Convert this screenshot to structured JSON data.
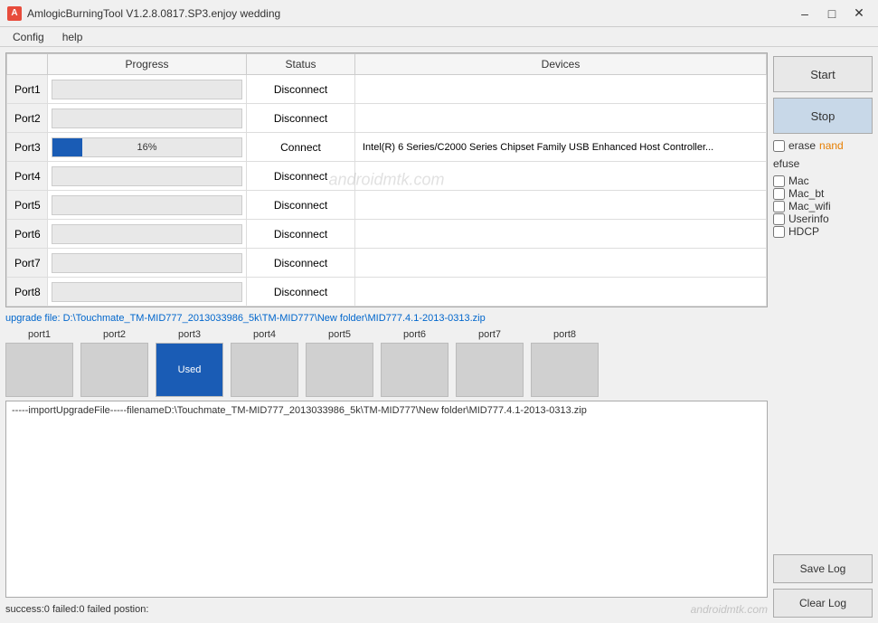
{
  "window": {
    "title": "AmlogicBurningTool  V1.2.8.0817.SP3.enjoy wedding",
    "icon_label": "A"
  },
  "menu": {
    "items": [
      "Config",
      "help"
    ]
  },
  "table": {
    "headers": [
      "Progress",
      "Status",
      "Devices"
    ],
    "rows": [
      {
        "port": "Port1",
        "progress": 0,
        "progress_text": "",
        "status": "Disconnect",
        "devices": ""
      },
      {
        "port": "Port2",
        "progress": 0,
        "progress_text": "",
        "status": "Disconnect",
        "devices": ""
      },
      {
        "port": "Port3",
        "progress": 16,
        "progress_text": "16%",
        "status": "Connect",
        "devices": "Intel(R) 6 Series/C2000 Series Chipset Family USB Enhanced Host Controller..."
      },
      {
        "port": "Port4",
        "progress": 0,
        "progress_text": "",
        "status": "Disconnect",
        "devices": ""
      },
      {
        "port": "Port5",
        "progress": 0,
        "progress_text": "",
        "status": "Disconnect",
        "devices": ""
      },
      {
        "port": "Port6",
        "progress": 0,
        "progress_text": "",
        "status": "Disconnect",
        "devices": ""
      },
      {
        "port": "Port7",
        "progress": 0,
        "progress_text": "",
        "status": "Disconnect",
        "devices": ""
      },
      {
        "port": "Port8",
        "progress": 0,
        "progress_text": "",
        "status": "Disconnect",
        "devices": ""
      }
    ],
    "watermark": "androidmtk.com"
  },
  "upgrade_file": "upgrade file: D:\\Touchmate_TM-MID777_2013033986_5k\\TM-MID777\\New folder\\MID777.4.1-2013-0313.zip",
  "thumbnails": {
    "ports": [
      {
        "label": "port1",
        "active": false,
        "text": ""
      },
      {
        "label": "port2",
        "active": false,
        "text": ""
      },
      {
        "label": "port3",
        "active": true,
        "text": "Used"
      },
      {
        "label": "port4",
        "active": false,
        "text": ""
      },
      {
        "label": "port5",
        "active": false,
        "text": ""
      },
      {
        "label": "port6",
        "active": false,
        "text": ""
      },
      {
        "label": "port7",
        "active": false,
        "text": ""
      },
      {
        "label": "port8",
        "active": false,
        "text": ""
      }
    ]
  },
  "log": {
    "content": "-----importUpgradeFile-----filenameD:\\Touchmate_TM-MID777_2013033986_5k\\TM-MID777\\New folder\\MID777.4.1-2013-0313.zip"
  },
  "status_bar": {
    "text": "success:0 failed:0 failed postion:",
    "watermark": "androidmtk.com"
  },
  "right_panel": {
    "start_label": "Start",
    "stop_label": "Stop",
    "erase_nand_label": "erase",
    "erase_nand_label2": "nand",
    "efuse_title": "efuse",
    "efuse_items": [
      "Mac",
      "Mac_bt",
      "Mac_wifi",
      "Userinfo",
      "HDCP"
    ],
    "save_log_label": "Save Log",
    "clear_log_label": "Clear Log"
  }
}
